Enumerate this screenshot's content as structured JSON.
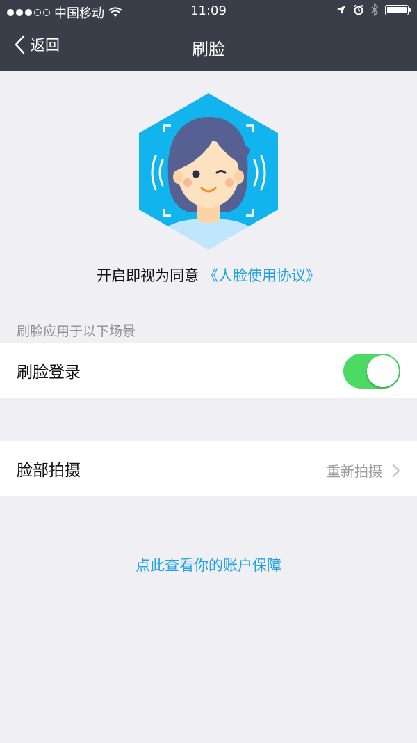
{
  "status_bar": {
    "carrier": "中国移动",
    "time": "11:09"
  },
  "nav": {
    "back_label": "返回",
    "title": "刷脸"
  },
  "agreement": {
    "prefix": "开启即视为同意",
    "link": "《人脸使用协议》"
  },
  "section_label": "刷脸应用于以下场景",
  "face_login": {
    "label": "刷脸登录",
    "enabled": true
  },
  "face_capture": {
    "label": "脸部拍摄",
    "action": "重新拍摄"
  },
  "account_link": "点此查看你的账户保障",
  "colors": {
    "header": "#393e48",
    "accent": "#1fa3e0",
    "toggle_on": "#4cd964",
    "background": "#efeff4"
  }
}
